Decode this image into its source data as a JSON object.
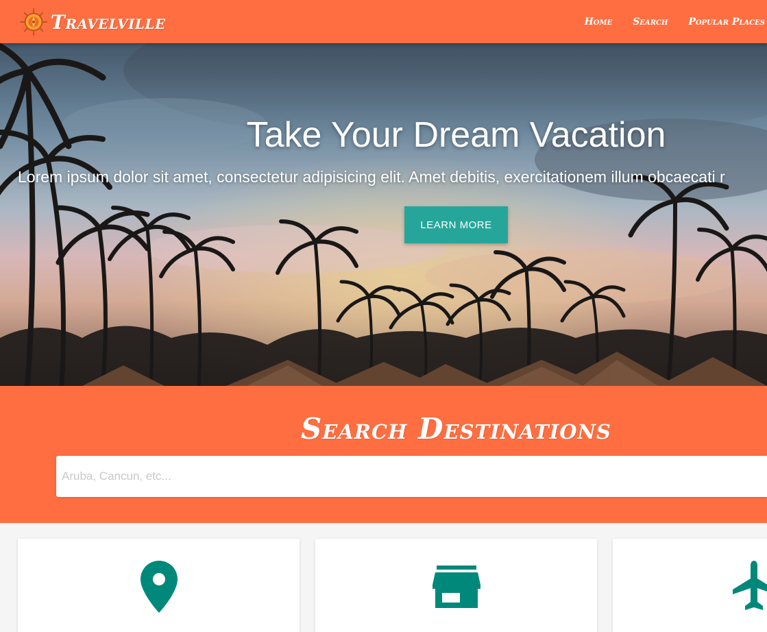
{
  "navbar": {
    "brand": "Travelville",
    "brand_logo_icon": "sun-compass-logo",
    "links": [
      "Home",
      "Search",
      "Popular Places"
    ]
  },
  "hero": {
    "title": "Take Your Dream Vacation",
    "subtitle": "Lorem ipsum dolor sit amet, consectetur adipisicing elit. Amet debitis, exercitationem illum obcaecati r",
    "button_label": "LEARN MORE"
  },
  "search": {
    "title": "Search Destinations",
    "placeholder": "Aruba, Cancun, etc..."
  },
  "cards": [
    {
      "icon": "map-pin-icon"
    },
    {
      "icon": "store-icon"
    },
    {
      "icon": "airplane-icon"
    }
  ],
  "colors": {
    "primary": "#ff6e40",
    "accent": "#26a69a",
    "icon_teal": "#00897b",
    "background": "#f5f5f5"
  }
}
